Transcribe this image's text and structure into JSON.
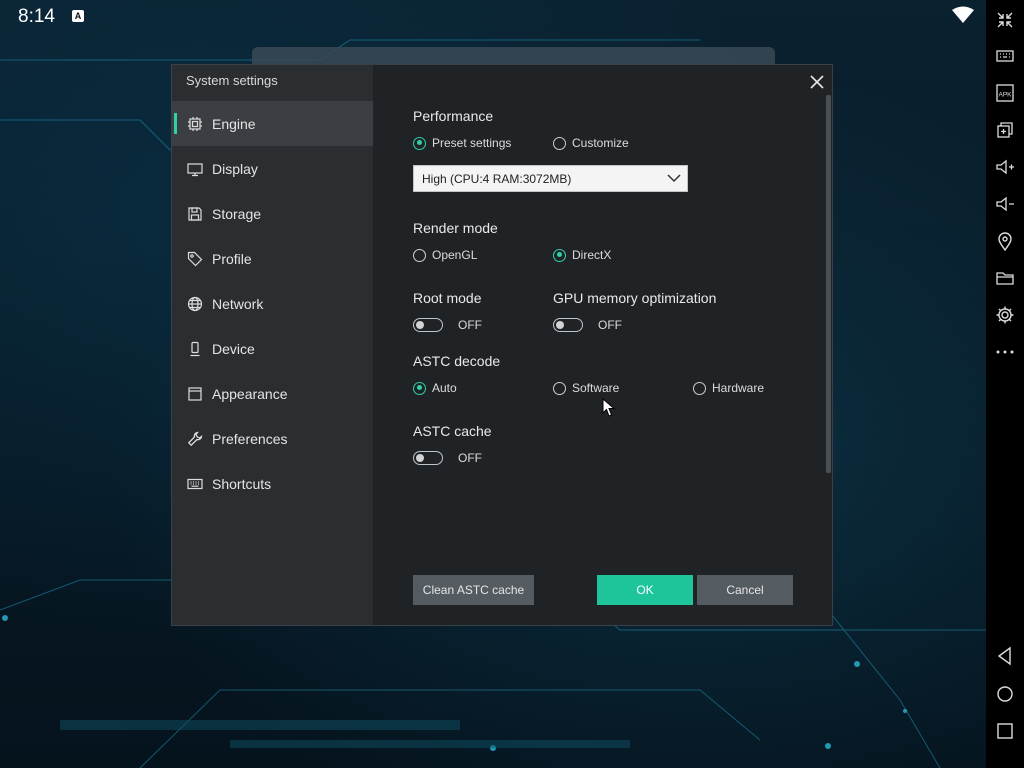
{
  "status_bar": {
    "time": "8:14",
    "badge": "A"
  },
  "dialog": {
    "title": "System settings",
    "nav": [
      {
        "label": "Engine",
        "icon": "chip-icon",
        "active": true
      },
      {
        "label": "Display",
        "icon": "monitor-icon"
      },
      {
        "label": "Storage",
        "icon": "save-icon"
      },
      {
        "label": "Profile",
        "icon": "tag-icon"
      },
      {
        "label": "Network",
        "icon": "globe-icon"
      },
      {
        "label": "Device",
        "icon": "phone-icon"
      },
      {
        "label": "Appearance",
        "icon": "window-icon"
      },
      {
        "label": "Preferences",
        "icon": "wrench-icon"
      },
      {
        "label": "Shortcuts",
        "icon": "keyboard-icon"
      }
    ],
    "performance": {
      "title": "Performance",
      "preset_label": "Preset settings",
      "customize_label": "Customize",
      "selected": "Preset settings",
      "select_value": "High (CPU:4 RAM:3072MB)"
    },
    "render_mode": {
      "title": "Render mode",
      "opengl_label": "OpenGL",
      "directx_label": "DirectX",
      "selected": "DirectX"
    },
    "root_mode": {
      "title": "Root mode",
      "state": "OFF"
    },
    "gpu_memory": {
      "title": "GPU memory optimization",
      "state": "OFF"
    },
    "astc_decode": {
      "title": "ASTC decode",
      "auto_label": "Auto",
      "software_label": "Software",
      "hardware_label": "Hardware",
      "selected": "Auto"
    },
    "astc_cache": {
      "title": "ASTC cache",
      "state": "OFF"
    },
    "buttons": {
      "clean": "Clean ASTC cache",
      "ok": "OK",
      "cancel": "Cancel"
    }
  },
  "toolbar": {
    "icons": [
      "collapse-icon",
      "keyboard-icon",
      "apk-icon",
      "add-window-icon",
      "volume-up-icon",
      "volume-down-icon",
      "location-icon",
      "folder-icon",
      "settings-icon",
      "more-icon",
      "back-icon",
      "home-icon",
      "recents-icon"
    ],
    "apk_text": "APK"
  },
  "colors": {
    "accent": "#1ec59b",
    "dialog_bg": "#202326",
    "sidebar_bg": "#2b2e31"
  }
}
